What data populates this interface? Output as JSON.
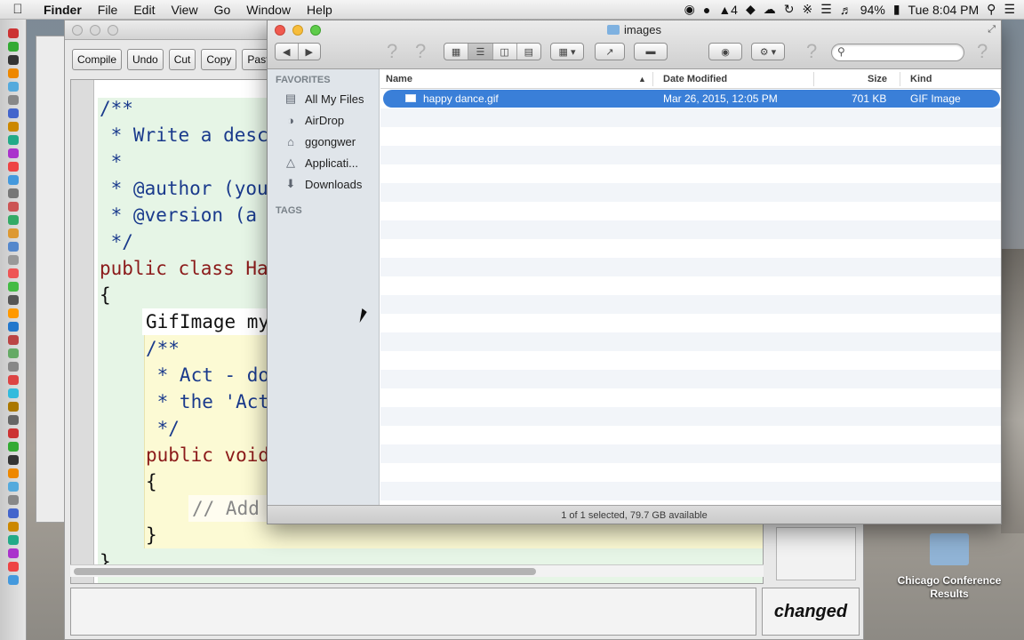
{
  "menubar": {
    "app_name": "Finder",
    "items": [
      "File",
      "Edit",
      "View",
      "Go",
      "Window",
      "Help"
    ],
    "status": {
      "battery": "94%",
      "clock": "Tue 8:04 PM",
      "badge": "4"
    }
  },
  "editor": {
    "toolbar": [
      "Compile",
      "Undo",
      "Cut",
      "Copy",
      "Past"
    ],
    "code": [
      "/**",
      " * Write a desc",
      " *",
      " * @author (you",
      " * @version (a",
      " */",
      "public class Ha",
      "{",
      "GifImage my",
      "/**",
      " * Act - do",
      " * the 'Act",
      " */",
      "public void",
      "{",
      "// Add",
      "}",
      "}"
    ],
    "status_label": "changed"
  },
  "finder": {
    "title": "images",
    "sidebar": {
      "favorites_heading": "FAVORITES",
      "tags_heading": "TAGS",
      "items": [
        {
          "label": "All My Files",
          "icon": "all-files-icon"
        },
        {
          "label": "AirDrop",
          "icon": "airdrop-icon"
        },
        {
          "label": "ggongwer",
          "icon": "home-icon"
        },
        {
          "label": "Applicati...",
          "icon": "applications-icon"
        },
        {
          "label": "Downloads",
          "icon": "downloads-icon"
        }
      ]
    },
    "columns": {
      "name": "Name",
      "date": "Date Modified",
      "size": "Size",
      "kind": "Kind"
    },
    "files": [
      {
        "name": "happy dance.gif",
        "date": "Mar 26, 2015, 12:05 PM",
        "size": "701 KB",
        "kind": "GIF Image",
        "selected": true
      }
    ],
    "status": "1 of 1 selected, 79.7 GB available",
    "accent": "#3a7fd8"
  },
  "desktop": {
    "folder_label": "Chicago Conference Results"
  }
}
